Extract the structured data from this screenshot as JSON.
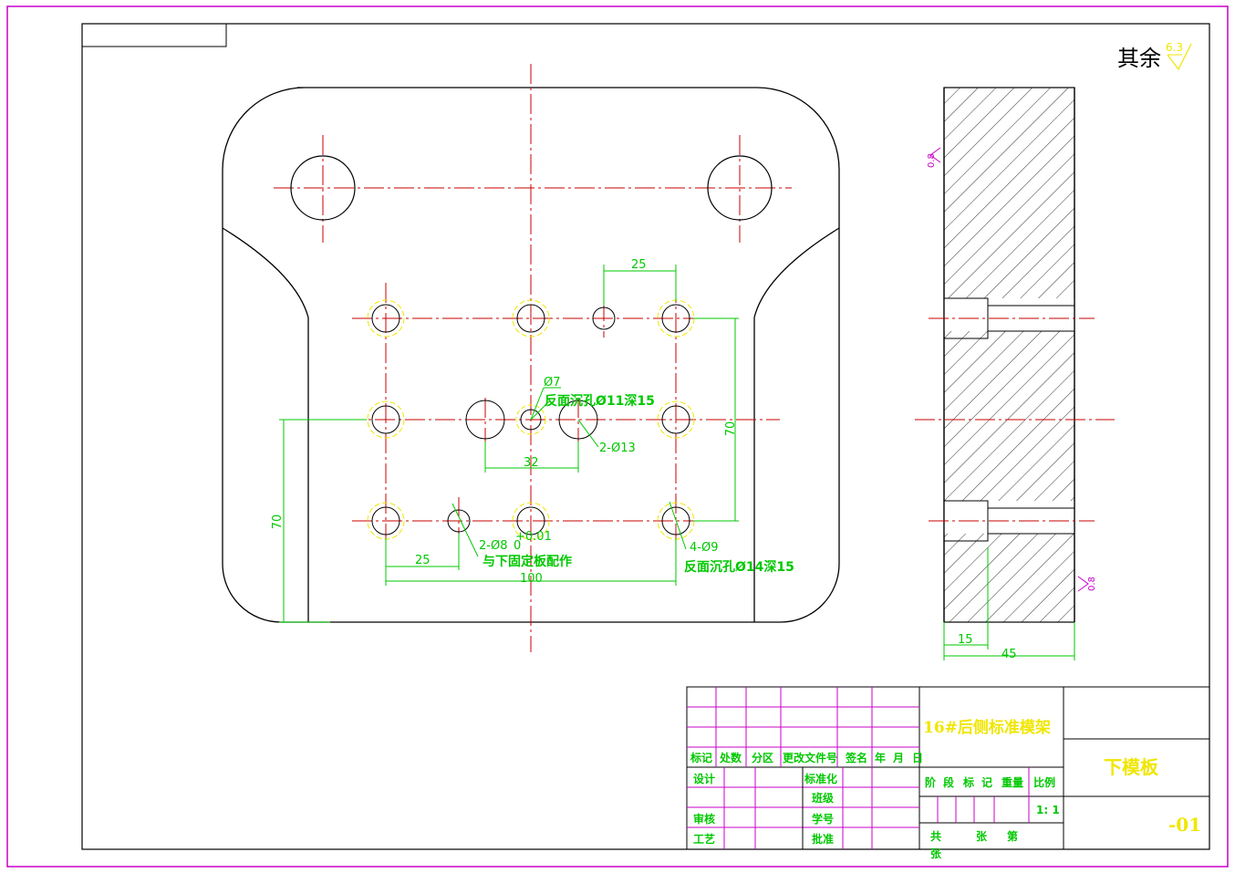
{
  "colors": {
    "outline": "#000000",
    "center_line": "#c80000",
    "dimension": "#00c800",
    "frame": "#c800c8",
    "title_text": "#f0e600",
    "hidden_hole": "#f0e600"
  },
  "roughness_note": {
    "label": "其余",
    "value": "6.3"
  },
  "dimensions": {
    "top_pitch": "25",
    "right_height": "70",
    "left_height": "70",
    "center_spacing": "32",
    "bottom_pitch": "25",
    "bottom_width": "100",
    "side_counterbore": "15",
    "side_thickness": "45"
  },
  "callouts": {
    "hole7": "Ø7",
    "counterbore11": "反面沉孔Ø11深15",
    "hole13": "2-Ø13",
    "dowel": "2-Ø8",
    "dowel_tol_upper": "+0.01",
    "dowel_tol_lower": "0",
    "dowel_note": "与下固定板配作",
    "hole9": "4-Ø9",
    "counterbore14": "反面沉孔Ø14深15",
    "side_rough_top": "0.8",
    "side_rough_bottom": "0.8"
  },
  "title_block": {
    "project": "16#后侧标准模架",
    "part_name": "下模板",
    "drawing_no": "-01",
    "scale": "1: 1",
    "headers": [
      "标记",
      "处数",
      "分区",
      "更改文件号",
      "签名",
      "年",
      "月",
      "日"
    ],
    "stage_labels": [
      "阶",
      "段",
      "标",
      "记",
      "重量",
      "比例"
    ],
    "sheet_labels": [
      "共",
      "张",
      "第",
      "张"
    ],
    "rows": {
      "design": "设计",
      "standardize": "标准化",
      "class": "班级",
      "review": "审核",
      "student_no": "学号",
      "process": "工艺",
      "approve": "批准"
    }
  }
}
